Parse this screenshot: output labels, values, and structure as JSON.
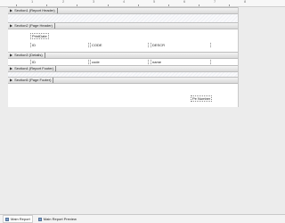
{
  "ruler": {
    "numbers": [
      "1",
      "2",
      "3",
      "4",
      "5",
      "6",
      "7",
      "8"
    ]
  },
  "sections": {
    "report_header": {
      "label": "Section1 (Report Header)"
    },
    "page_header": {
      "label": "Section2 (Page Header)"
    },
    "details": {
      "label": "Section3 (Details)"
    },
    "report_footer": {
      "label": "Section4 (Report Footer)"
    },
    "page_footer": {
      "label": "Section5 (Page Footer)"
    }
  },
  "page_header_fields": {
    "print_date": "PrintDate",
    "id": "ID",
    "code": "CODE",
    "descr": "DESCR"
  },
  "details_fields": {
    "id": "ID",
    "code": "code",
    "name": "name"
  },
  "page_footer_fields": {
    "page_number": "Pe Number"
  },
  "tabs": [
    {
      "label": "Main Report",
      "active": true
    },
    {
      "label": "Main Report Preview",
      "active": false
    }
  ]
}
